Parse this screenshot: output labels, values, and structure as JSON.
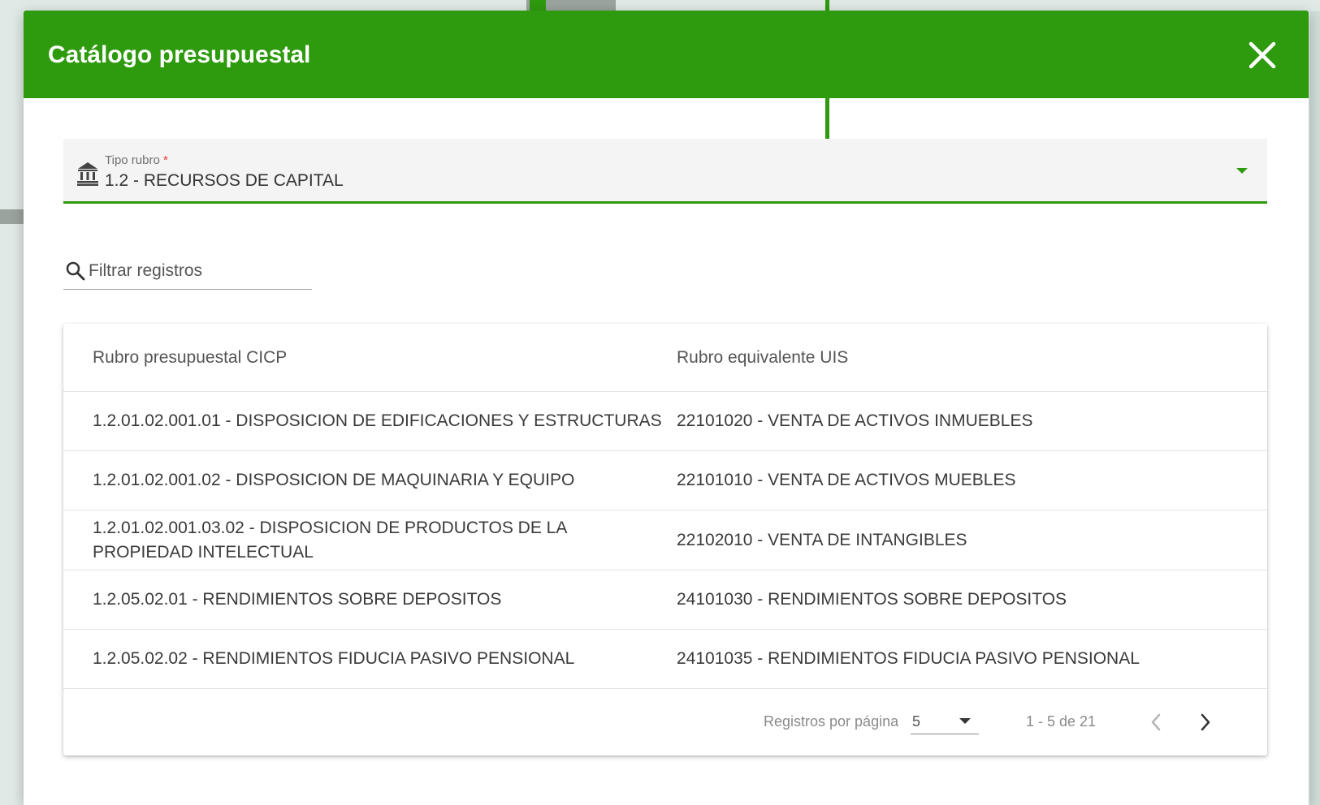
{
  "dialog": {
    "title": "Catálogo presupuestal",
    "close_icon": "close-icon"
  },
  "tipo_rubro": {
    "label": "Tipo rubro",
    "required_mark": "*",
    "value": "1.2 - RECURSOS DE CAPITAL",
    "icon": "bank-icon"
  },
  "filter": {
    "placeholder": "Filtrar registros",
    "icon": "search-icon"
  },
  "table": {
    "headers": [
      "Rubro presupuestal CICP",
      "Rubro equivalente UIS"
    ],
    "rows": [
      [
        "1.2.01.02.001.01 - DISPOSICION DE EDIFICACIONES Y ESTRUCTURAS",
        "22101020 - VENTA DE ACTIVOS INMUEBLES"
      ],
      [
        "1.2.01.02.001.02 - DISPOSICION DE MAQUINARIA Y EQUIPO",
        "22101010 - VENTA DE ACTIVOS MUEBLES"
      ],
      [
        "1.2.01.02.001.03.02 - DISPOSICION DE PRODUCTOS DE LA PROPIEDAD INTELECTUAL",
        "22102010 - VENTA DE INTANGIBLES"
      ],
      [
        "1.2.05.02.01 - RENDIMIENTOS SOBRE DEPOSITOS",
        "24101030 - RENDIMIENTOS SOBRE DEPOSITOS"
      ],
      [
        "1.2.05.02.02 - RENDIMIENTOS FIDUCIA PASIVO PENSIONAL",
        "24101035 - RENDIMIENTOS FIDUCIA PASIVO PENSIONAL"
      ]
    ]
  },
  "paginator": {
    "items_per_page_label": "Registros por página",
    "items_per_page": "5",
    "range_label": "1 - 5 de 21"
  },
  "colors": {
    "brand_green": "#2e9a0e",
    "required_red": "#e53935"
  }
}
